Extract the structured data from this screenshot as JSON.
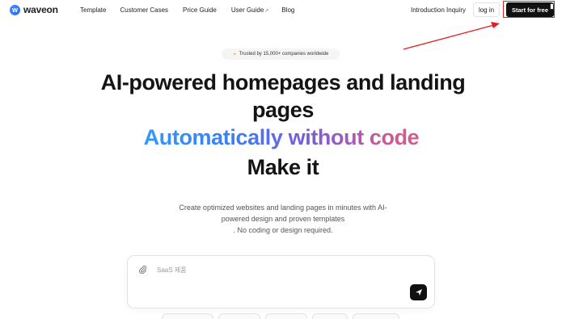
{
  "brand": {
    "name": "waveon",
    "mark": "w"
  },
  "nav": {
    "items": [
      {
        "label": "Template"
      },
      {
        "label": "Customer Cases"
      },
      {
        "label": "Price Guide"
      },
      {
        "label": "User Guide"
      },
      {
        "label": "Blog"
      }
    ],
    "inquiry_label": "Introduction Inquiry",
    "login_label": "log in",
    "start_label": "Start for free"
  },
  "hero": {
    "badge_text": "Trusted by 15,000+ companies worldwide",
    "title_line1": "AI-powered homepages and landing",
    "title_line2": "pages",
    "title_gradient": "Automatically without code",
    "title_line4": "Make it",
    "subtitle_line1": "Create optimized websites and landing pages in minutes with AI-",
    "subtitle_line2": "powered design and proven templates",
    "subtitle_line3": ". No coding or design required."
  },
  "prompt": {
    "placeholder": "SaaS 제품",
    "value": ""
  },
  "colors": {
    "accent_blue": "#2f9bff",
    "accent_purple": "#7b5cd6",
    "accent_pink": "#d65f8a",
    "highlight_red": "#e02020",
    "button_dark": "#111111"
  }
}
